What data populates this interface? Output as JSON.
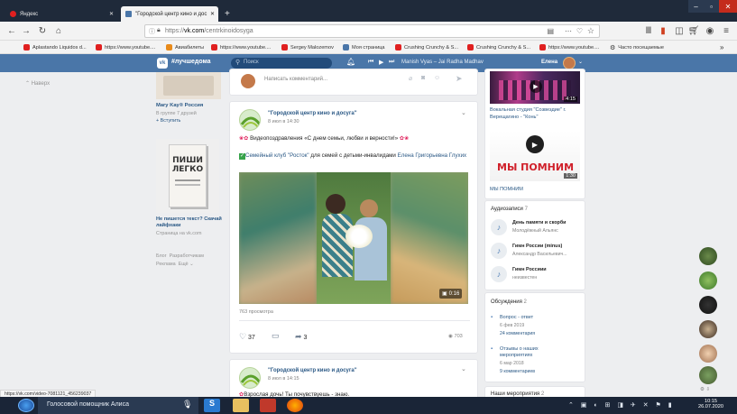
{
  "browser": {
    "tabs": [
      {
        "label": "Яндекс"
      },
      {
        "label": "\"Городской центр кино и дос"
      }
    ],
    "url": "https://vk.com/centrkinoidosyga",
    "url_prefix": "https://",
    "url_host": "vk.com",
    "url_path": "/centrkinoidosyga",
    "bookmarks": [
      "Aplastando Liquidos d...",
      "https://www.youtube....",
      "Авиабилеты",
      "https://www.youtube....",
      "Sergey Malozemov",
      "Моя страница",
      "Crushing Crunchy & S...",
      "Crushing Crunchy & S...",
      "https://www.youtube....",
      "Часто посещаемые"
    ],
    "status_url": "https://vk.com/video-7081121_456239037"
  },
  "vk": {
    "logo_text": "#лучшедома",
    "search_placeholder": "Поиск",
    "player_track": "Manish Vyas – Jai Radha Madhav",
    "user_name": "Елена"
  },
  "left": {
    "back_link": "Наверх",
    "ad1": {
      "title": "Mary Kay® Россия",
      "sub": "В группе 7 друзей",
      "action": "+ Вступить"
    },
    "ad2": {
      "book_line1": "ПИШИ",
      "book_line2": "ЛЕГКО",
      "title": "Не пишется текст? Скачай лайфхаки",
      "sub": "Страница на vk.com"
    },
    "footer": [
      "Блог",
      "Разработчикам",
      "Реклама",
      "Ещё"
    ]
  },
  "comment": {
    "placeholder": "Написать комментарий..."
  },
  "post1": {
    "group": "\"Городской центр кино и досуга\"",
    "date": "8 июл в 14:30",
    "line1": "Видеопоздравления «С днем семьи, любви и верности!»",
    "line2_link": "Семейный клуб \"Росток\"",
    "line2_text": " для семей с детьми-инвалидами ",
    "line2_name": "Елена Григорьевна Глухих",
    "video_duration": "0:16",
    "views": "763 просмотра",
    "likes": "37",
    "shares": "3",
    "view_count": "703"
  },
  "post2": {
    "group": "\"Городской центр кино и досуга\"",
    "date": "8 июл в 14:15",
    "line1": "Взрослая дочь! Ты почувствуешь - знаю."
  },
  "right": {
    "video1": {
      "duration": "4:15",
      "title": "Вокальная студия \"Созвездие\" г. Верещагино - \"Конь\""
    },
    "video2": {
      "banner": "МЫ ПОМНИМ",
      "duration": "1:30",
      "title": "МЫ ПОМНИМ"
    },
    "audio_header": "Аудиозаписи",
    "audio_count": "7",
    "tracks": [
      {
        "title": "День памяти и скорби",
        "artist": "Молодёжный Альянс"
      },
      {
        "title": "Гимн России (minus)",
        "artist": "Александр Васильевич..."
      },
      {
        "title": "Гимн Россиии",
        "artist": "неизвестен"
      }
    ],
    "discussions_header": "Обсуждения",
    "discussions_count": "2",
    "topics": [
      {
        "title": "Вопрос - ответ",
        "date": "6 фев 2019",
        "comments": "24 комментария"
      },
      {
        "title": "Отзывы о наших мероприятиях",
        "date": "6 мар 2018",
        "comments": "9 комментариев"
      }
    ],
    "events_header": "Наши мероприятия",
    "events_count": "2"
  },
  "taskbar": {
    "assistant": "Голосовой помощник Алиса",
    "time": "10:15",
    "date": "26.07.2020"
  },
  "colors": {
    "vk_blue": "#4a76a8",
    "link": "#2a5885",
    "taskbar": "#1a2537"
  }
}
